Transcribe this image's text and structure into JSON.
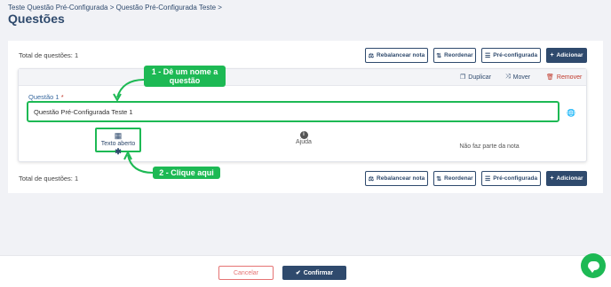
{
  "breadcrumb": {
    "item1": "Teste Questão Pré-Configurada",
    "sep": ">",
    "item2": "Questão Pré-Configurada Teste",
    "tail": ">"
  },
  "page_title": "Questões",
  "totals_label": "Total de questões: 1",
  "toolbar": {
    "rebalance": "Rebalancear nota",
    "reorder": "Reordenar",
    "preconfig": "Pré-configurada",
    "add": "Adicionar"
  },
  "question": {
    "actions": {
      "duplicate": "Duplicar",
      "move": "Mover",
      "remove": "Remover"
    },
    "label": "Questão 1",
    "required_mark": "*",
    "value": "Questão Pré-Configurada Teste 1",
    "options": {
      "open_text": "Texto aberto",
      "open_text_star": "✱",
      "help": "Ajuda",
      "not_graded": "Não faz parte da nota"
    }
  },
  "callouts": {
    "step1_line1": "1 - Dê um nome a",
    "step1_line2": "questão",
    "step2": "2 - Clique aqui"
  },
  "footer": {
    "cancel": "Cancelar",
    "confirm": "Confirmar"
  },
  "colors": {
    "primary": "#2f4a6d",
    "highlight": "#1db954",
    "danger": "#c0392b"
  }
}
